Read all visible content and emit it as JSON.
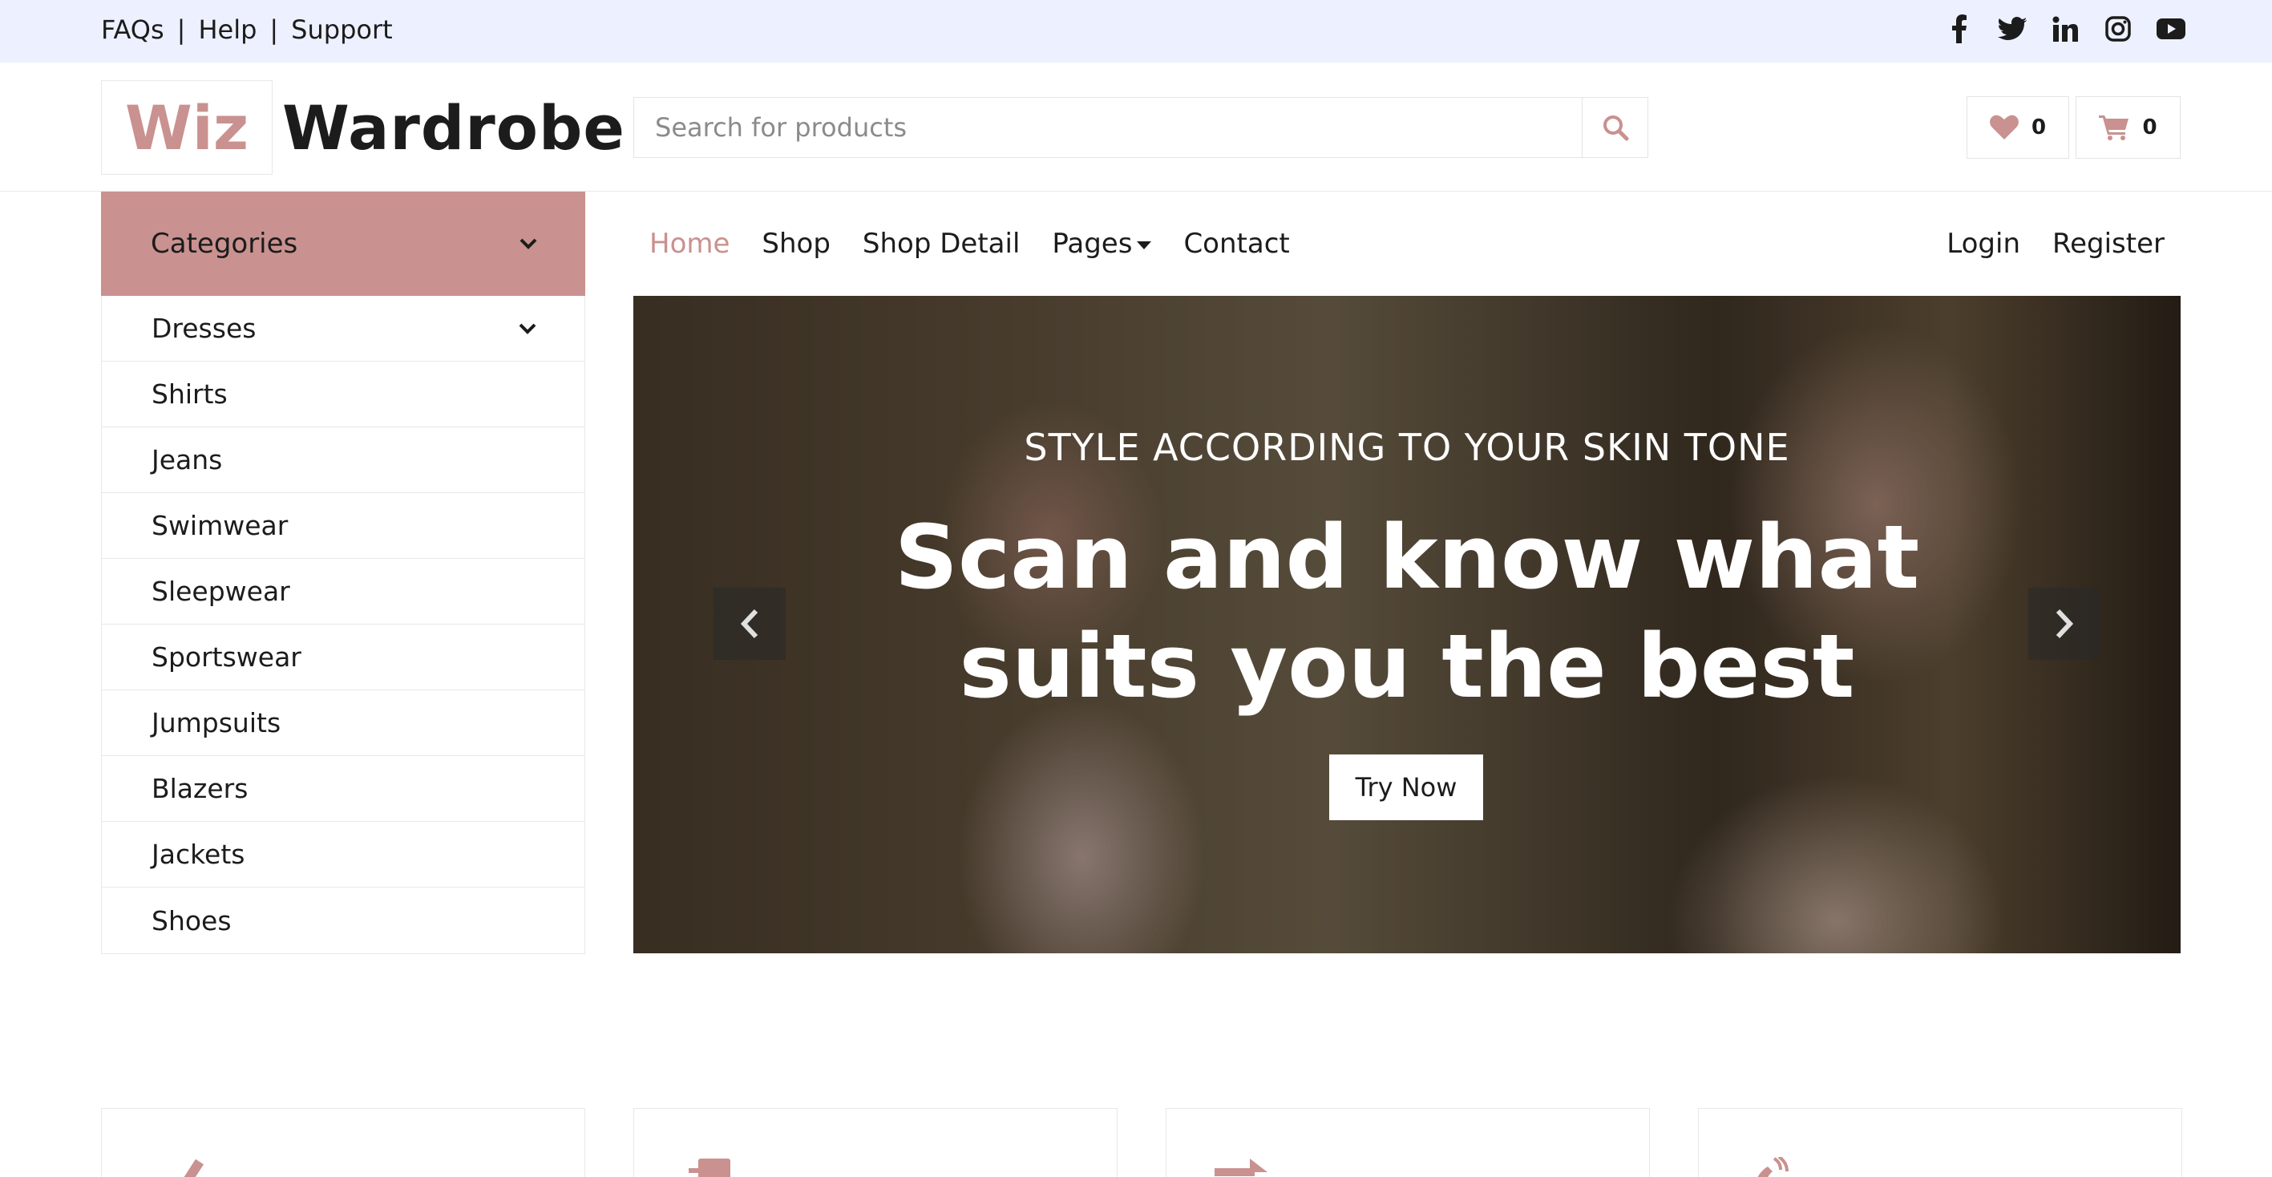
{
  "topbar": {
    "links": [
      "FAQs",
      "Help",
      "Support"
    ],
    "social_icons": [
      "facebook-icon",
      "twitter-icon",
      "linkedin-icon",
      "instagram-icon",
      "youtube-icon"
    ]
  },
  "brand": {
    "part1": "Wiz",
    "part2": "Wardrobe",
    "accent_color": "#c9918f"
  },
  "search": {
    "placeholder": "Search for products"
  },
  "header_buttons": {
    "wishlist_count": "0",
    "cart_count": "0"
  },
  "categories": {
    "title": "Categories",
    "items": [
      "Dresses",
      "Shirts",
      "Jeans",
      "Swimwear",
      "Sleepwear",
      "Sportswear",
      "Jumpsuits",
      "Blazers",
      "Jackets",
      "Shoes"
    ]
  },
  "nav": {
    "items": [
      "Home",
      "Shop",
      "Shop Detail",
      "Pages",
      "Contact"
    ],
    "active": "Home",
    "right": [
      "Login",
      "Register"
    ]
  },
  "hero": {
    "subtitle": "STYLE ACCORDING TO YOUR SKIN TONE",
    "title_line1": "Scan and know what",
    "title_line2": "suits you the best",
    "cta": "Try Now"
  },
  "features": [
    "check-icon",
    "shipping-icon",
    "exchange-icon",
    "phone-icon"
  ]
}
